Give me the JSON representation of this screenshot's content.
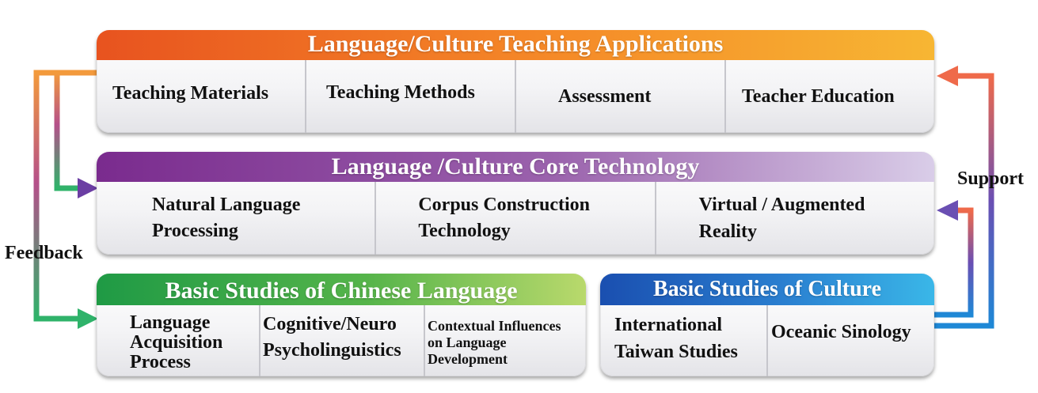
{
  "teaching": {
    "title": "Language/Culture Teaching Applications",
    "items": [
      "Teaching Materials",
      "Teaching Methods",
      "Assessment",
      "Teacher Education"
    ]
  },
  "core": {
    "title": "Language /Culture Core Technology",
    "items": [
      "Natural Language\nProcessing",
      "Corpus Construction\nTechnology",
      "Virtual / Augmented\nReality"
    ]
  },
  "chinese": {
    "title": "Basic Studies of Chinese Language",
    "items": [
      "Language\nAcquisition\nProcess",
      "Cognitive/Neuro\nPsycholinguistics",
      "Contextual Influences\non Language\nDevelopment"
    ]
  },
  "culture": {
    "title": "Basic Studies of Culture",
    "items": [
      "International\nTaiwan Studies",
      "Oceanic Sinology"
    ]
  },
  "labels": {
    "feedback": "Feedback",
    "support": "Support"
  },
  "colors": {
    "teaching": [
      "#e8531f",
      "#f7b633"
    ],
    "core": [
      "#7a2b8e",
      "#d9cde8"
    ],
    "chinese": [
      "#1f9a45",
      "#b9d96c"
    ],
    "culture": [
      "#1a4fb0",
      "#3ab7e8"
    ]
  }
}
